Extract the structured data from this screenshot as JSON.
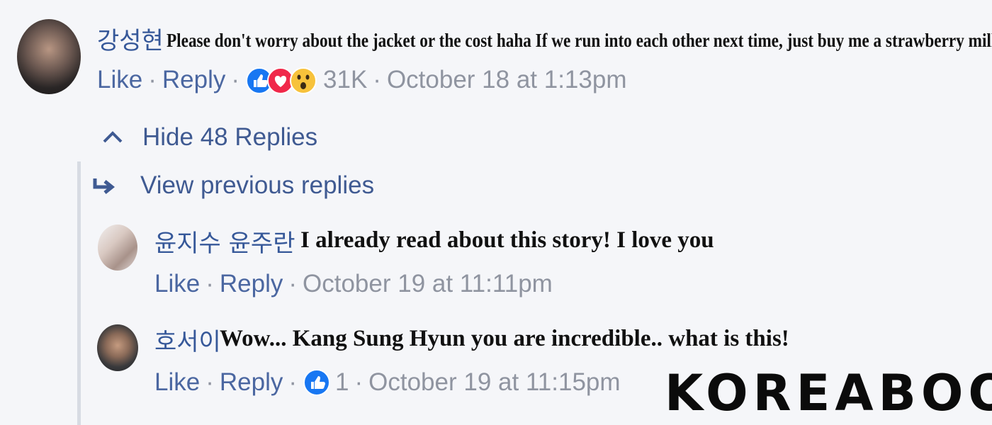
{
  "main_comment": {
    "author": "강성현",
    "text": "Please don't worry about the jacket or the cost haha If we run into each other next time, just buy me a strawberry milk.",
    "like_label": "Like",
    "reply_label": "Reply",
    "reaction_count": "31K",
    "timestamp": "October 18 at 1:13pm",
    "reactions": [
      "like-icon",
      "love-icon",
      "wow-icon"
    ]
  },
  "thread": {
    "hide_replies_label": "Hide 48 Replies",
    "view_previous_label": "View previous replies"
  },
  "replies": [
    {
      "author": "윤지수 윤주란",
      "text": "I already read about this story! I love you",
      "like_label": "Like",
      "reply_label": "Reply",
      "timestamp": "October 19 at 11:11pm"
    },
    {
      "author": "호서이",
      "text": "Wow... Kang Sung Hyun you are incredible.. what is this!",
      "like_label": "Like",
      "reply_label": "Reply",
      "reaction_count": "1",
      "timestamp": "October 19 at 11:15pm",
      "reactions": [
        "like-icon"
      ]
    }
  ],
  "watermark": "KOREABOO",
  "colors": {
    "background": "#f5f6f9",
    "link_blue": "#365899",
    "meta_gray": "#8f94a0",
    "like_blue": "#1877f2",
    "love_red": "#f0284a",
    "wow_yellow": "#f7c23b"
  }
}
